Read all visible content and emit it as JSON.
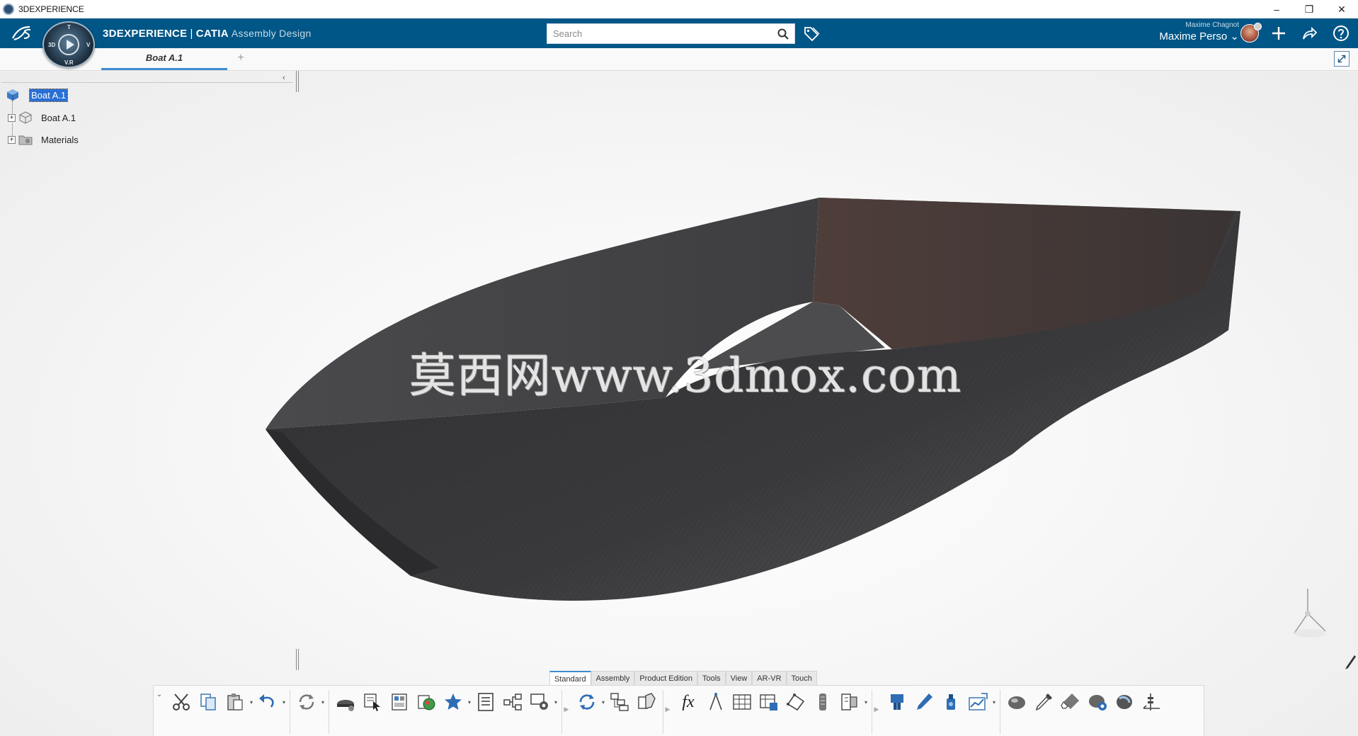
{
  "window": {
    "title": "3DEXPERIENCE",
    "controls": {
      "minimize": "–",
      "restore": "❐",
      "close": "✕"
    }
  },
  "header": {
    "brand_3dx": "3DEXPERIENCE",
    "brand_separator": "|",
    "brand_catia": "CATIA",
    "app_name": "Assembly Design",
    "compass": {
      "top": "T",
      "left": "3D",
      "right": "V",
      "bottom": "V.R"
    },
    "search_placeholder": "Search",
    "user_small": "Maxime Chagnot",
    "user_name": "Maxime Perso",
    "user_chevron": "⌄",
    "icons": [
      "search-icon",
      "tag-icon",
      "plus-icon",
      "share-icon",
      "help-icon"
    ]
  },
  "tabs": {
    "active_label": "Boat A.1",
    "add_label": "+"
  },
  "tree": {
    "collapse_label": "‹",
    "root": "Boat A.1",
    "items": [
      {
        "label": "Boat A.1",
        "icon": "product-icon"
      },
      {
        "label": "Materials",
        "icon": "materials-folder-icon"
      }
    ]
  },
  "viewport": {
    "watermark": "莫西网www.3dmox.com",
    "model": "boat-hull",
    "colors": {
      "hull": "#3b3b3e",
      "interior": "#4a3b38",
      "background": "#f2f2f2"
    }
  },
  "action_bar": {
    "tabs": [
      "Standard",
      "Assembly",
      "Product Edition",
      "Tools",
      "View",
      "AR-VR",
      "Touch"
    ],
    "active_tab": "Standard",
    "fx_label": "fx",
    "more_chevron": "⌄",
    "tools": [
      "cut-icon",
      "copy-icon",
      "paste-icon",
      "undo-icon",
      "update-icon",
      "insert-product-icon",
      "select-icon",
      "catalog-icon",
      "apply-material-icon",
      "favorite-icon",
      "properties-icon",
      "relations-icon",
      "settings-icon",
      "refresh-icon",
      "tree-reorder-icon",
      "explode-icon",
      "formula-icon",
      "measure-icon",
      "table-icon",
      "design-table-icon",
      "geometry-icon",
      "ruler-icon",
      "scale-icon",
      "publish-icon",
      "pen-icon",
      "paint-icon",
      "graph-icon",
      "render-icon",
      "eyedropper-icon",
      "eraser-icon",
      "material-ball-icon",
      "lighting-icon",
      "compass-icon"
    ]
  }
}
